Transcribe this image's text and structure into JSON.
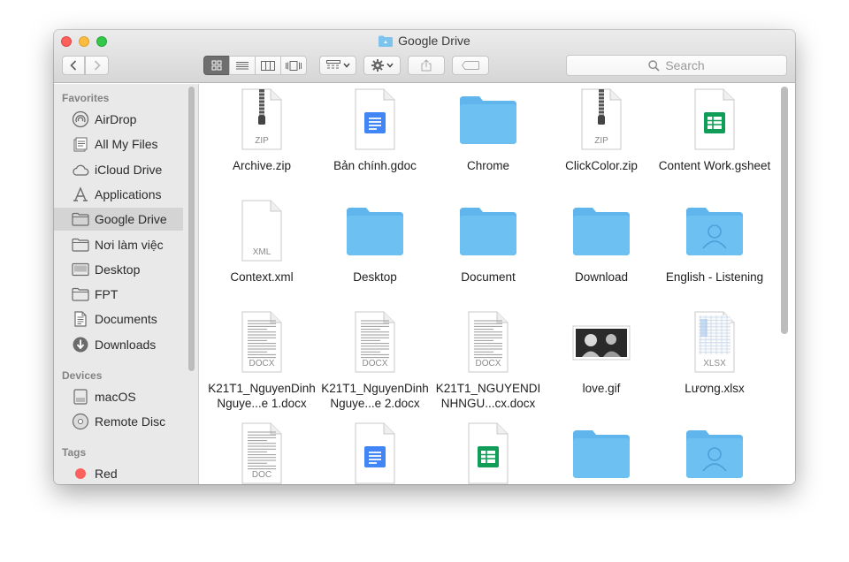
{
  "window": {
    "title": "Google Drive"
  },
  "search": {
    "placeholder": "Search"
  },
  "sidebar": {
    "sections": [
      {
        "id": "favorites",
        "title": "Favorites"
      },
      {
        "id": "devices",
        "title": "Devices"
      },
      {
        "id": "tags",
        "title": "Tags"
      }
    ],
    "favorites": [
      {
        "label": "AirDrop",
        "icon": "airdrop-icon"
      },
      {
        "label": "All My Files",
        "icon": "all-files-icon"
      },
      {
        "label": "iCloud Drive",
        "icon": "cloud-icon"
      },
      {
        "label": "Applications",
        "icon": "applications-icon"
      },
      {
        "label": "Google Drive",
        "icon": "folder-icon",
        "selected": true
      },
      {
        "label": "Nơi làm việc",
        "icon": "folder-icon"
      },
      {
        "label": "Desktop",
        "icon": "desktop-icon"
      },
      {
        "label": "FPT",
        "icon": "folder-icon"
      },
      {
        "label": "Documents",
        "icon": "documents-icon"
      },
      {
        "label": "Downloads",
        "icon": "downloads-icon"
      }
    ],
    "devices": [
      {
        "label": "macOS",
        "icon": "hard-drive-icon"
      },
      {
        "label": "Remote Disc",
        "icon": "disc-icon"
      }
    ],
    "tags": [
      {
        "label": "Red",
        "color": "#fc605c"
      }
    ]
  },
  "files": [
    {
      "name": "Archive.zip",
      "type": "zip",
      "badge": "ZIP"
    },
    {
      "name": "Bản chính.gdoc",
      "type": "gdoc"
    },
    {
      "name": "Chrome",
      "type": "folder"
    },
    {
      "name": "ClickColor.zip",
      "type": "zip",
      "badge": "ZIP"
    },
    {
      "name": "Content Work.gsheet",
      "type": "gsheet"
    },
    {
      "name": "Context.xml",
      "type": "xml",
      "badge": "XML"
    },
    {
      "name": "Desktop",
      "type": "folder"
    },
    {
      "name": "Document",
      "type": "folder"
    },
    {
      "name": "Download",
      "type": "folder"
    },
    {
      "name": "English - Listening",
      "type": "shared-folder"
    },
    {
      "name": "K21T1_NguyenDinhNguye...e 1.docx",
      "type": "docx",
      "badge": "DOCX"
    },
    {
      "name": "K21T1_NguyenDinhNguye...e 2.docx",
      "type": "docx",
      "badge": "DOCX"
    },
    {
      "name": "K21T1_NGUYENDINHNGU...cx.docx",
      "type": "docx",
      "badge": "DOCX"
    },
    {
      "name": "love.gif",
      "type": "image"
    },
    {
      "name": "Lương.xlsx",
      "type": "xlsx",
      "badge": "XLSX"
    },
    {
      "name": "",
      "type": "doc",
      "badge": "DOC"
    },
    {
      "name": "",
      "type": "gdoc"
    },
    {
      "name": "",
      "type": "gsheet"
    },
    {
      "name": "",
      "type": "folder"
    },
    {
      "name": "",
      "type": "shared-folder"
    }
  ],
  "colors": {
    "folder": "#6cc1f2",
    "gdoc": "#4285f4",
    "gsheet": "#0f9d58",
    "tag_red": "#fc605c"
  }
}
